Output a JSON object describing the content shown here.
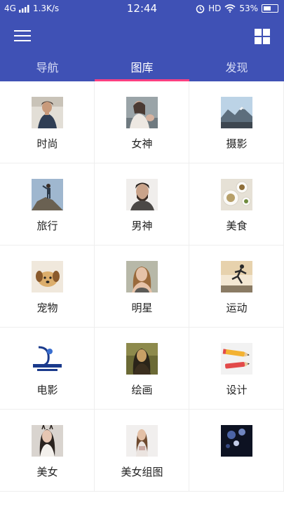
{
  "status": {
    "network": "4G",
    "speed": "1.3K/s",
    "time": "12:44",
    "hd": "HD",
    "battery": "53%"
  },
  "tabs": [
    {
      "label": "导航",
      "active": false
    },
    {
      "label": "图库",
      "active": true
    },
    {
      "label": "发现",
      "active": false
    }
  ],
  "accent": "#ff4081",
  "brand": "#3f51b5",
  "categories": [
    {
      "label": "时尚",
      "icon": "fashion-photo"
    },
    {
      "label": "女神",
      "icon": "goddess-photo"
    },
    {
      "label": "摄影",
      "icon": "photography-photo"
    },
    {
      "label": "旅行",
      "icon": "travel-photo"
    },
    {
      "label": "男神",
      "icon": "male-idol-photo"
    },
    {
      "label": "美食",
      "icon": "food-photo"
    },
    {
      "label": "宠物",
      "icon": "pet-photo"
    },
    {
      "label": "明星",
      "icon": "celebrity-photo"
    },
    {
      "label": "运动",
      "icon": "sports-photo"
    },
    {
      "label": "电影",
      "icon": "dreamworks-logo"
    },
    {
      "label": "绘画",
      "icon": "painting-photo"
    },
    {
      "label": "设计",
      "icon": "design-pencil"
    },
    {
      "label": "美女",
      "icon": "beauty-photo"
    },
    {
      "label": "美女组图",
      "icon": "beauty-set-photo"
    },
    {
      "label": "",
      "icon": "dark-photo"
    }
  ]
}
